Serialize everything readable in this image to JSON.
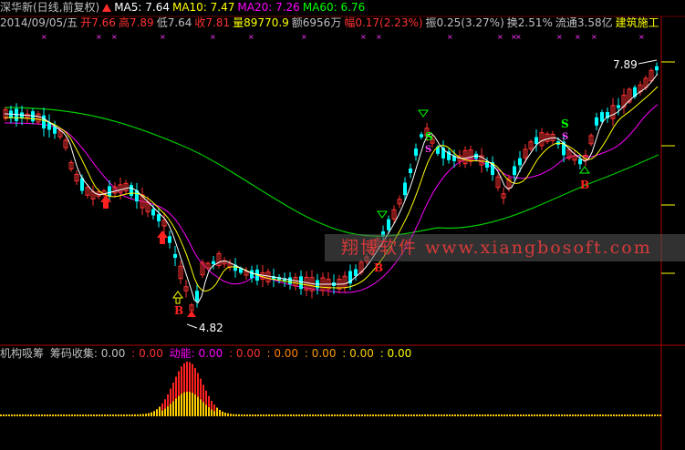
{
  "header": {
    "stock_name": "深华新(日线,前复权)",
    "arrow_icon": "up-arrow-icon",
    "ma5": "MA5: 7.64",
    "ma10": "MA10: 7.47",
    "ma20": "MA20: 7.26",
    "ma60": "MA60: 6.76",
    "date": "2014/09/05/五",
    "open": "开7.66",
    "high": "高7.89",
    "low": "低7.64",
    "close": "收7.81",
    "volume": "量89770.9",
    "amount": "额6956万",
    "range": "幅0.17(2.23%)",
    "amplitude": "振0.25(3.27%)",
    "turnover": "换2.51%",
    "float_cap": "流通3.58亿",
    "sector": "建筑施工"
  },
  "chart_labels": {
    "high_price": "7.89",
    "low_price": "4.82",
    "b_label": "B",
    "s_label": "S"
  },
  "indicator": {
    "name": "机构吸筹",
    "chip_label": "筹码收集: 0.00",
    "v1": ": 0.00",
    "momentum_label": "动能: 0.00",
    "v2": ": 0.00",
    "v3": ": 0.00",
    "v4": ": 0.00",
    "v5": ": 0.00",
    "v6": ": 0.00"
  },
  "watermark": {
    "text": "翔博软件 www.xiangbosoft.com"
  },
  "colors": {
    "ma5": "#ffffff",
    "ma10": "#ffff00",
    "ma20": "#ff00ff",
    "ma60": "#00ff00",
    "up": "#ff3232",
    "down": "#00ffff",
    "text_gray": "#c0c0c0",
    "text_yellow": "#ffff00",
    "text_red": "#ff3232"
  }
}
